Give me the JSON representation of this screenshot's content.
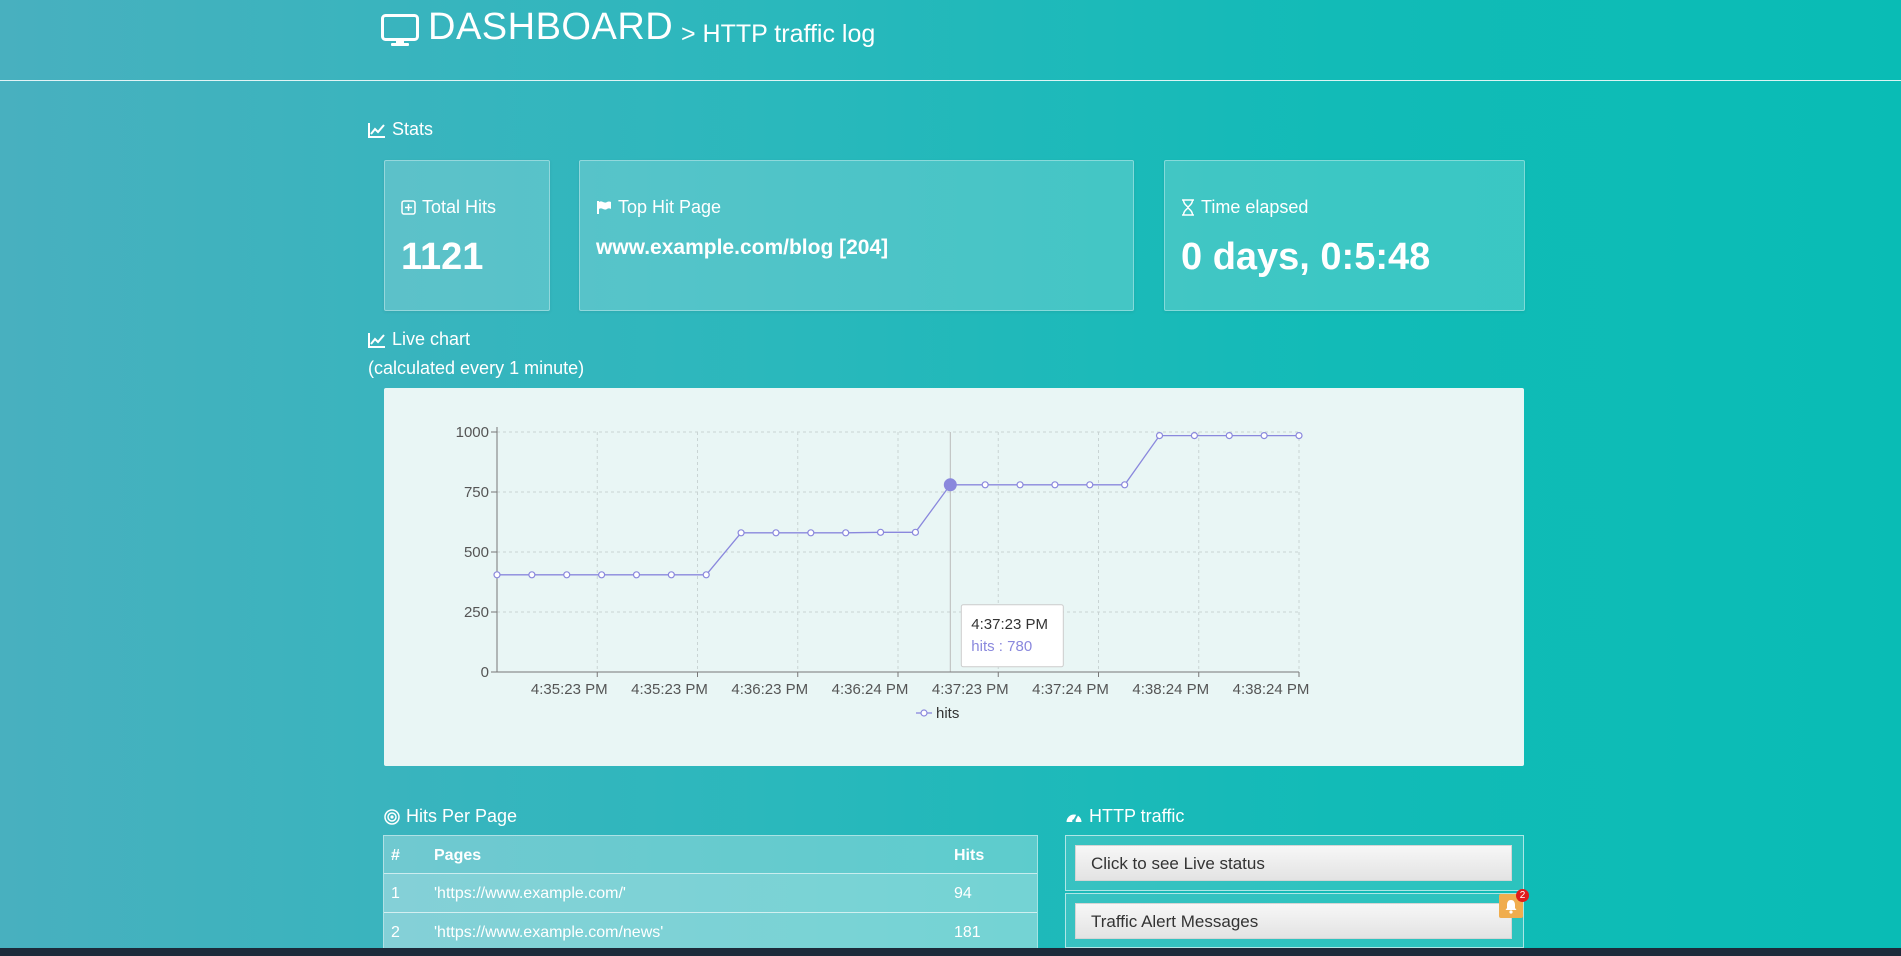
{
  "header": {
    "title": "DASHBOARD",
    "subtitle": "> HTTP traffic log"
  },
  "stats": {
    "label": "Stats",
    "total_hits": {
      "label": "Total Hits",
      "value": "1121"
    },
    "top_hit_page": {
      "label": "Top Hit Page",
      "value": "www.example.com/blog [204]"
    },
    "time_elapsed": {
      "label": "Time elapsed",
      "value": "0 days, 0:5:48"
    }
  },
  "live_chart": {
    "label": "Live chart",
    "note": "(calculated every 1 minute)"
  },
  "chart_data": {
    "type": "line",
    "series": [
      {
        "name": "hits",
        "values": [
          405,
          405,
          405,
          405,
          405,
          405,
          405,
          580,
          580,
          580,
          580,
          582,
          582,
          780,
          780,
          780,
          780,
          780,
          780,
          985,
          985,
          985,
          985,
          985
        ]
      }
    ],
    "x_tick_labels": [
      "4:35:23 PM",
      "4:35:23 PM",
      "4:36:23 PM",
      "4:36:24 PM",
      "4:37:23 PM",
      "4:37:24 PM",
      "4:38:24 PM",
      "4:38:24 PM"
    ],
    "y_ticks": [
      0,
      250,
      500,
      750,
      1000
    ],
    "ylim": [
      0,
      1000
    ],
    "grid": true,
    "legend": "bottom-center",
    "tooltip": {
      "time": "4:37:23 PM",
      "text": "hits : 780",
      "index": 13
    },
    "color": "#8a88dd"
  },
  "hits_per_page": {
    "label": "Hits Per Page",
    "columns": [
      "#",
      "Pages",
      "Hits"
    ],
    "rows": [
      [
        "1",
        "'https://www.example.com/'",
        "94"
      ],
      [
        "2",
        "'https://www.example.com/news'",
        "181"
      ]
    ]
  },
  "http_traffic": {
    "label": "HTTP traffic",
    "live_status_button": "Click to see Live status",
    "alerts_button": "Traffic Alert Messages",
    "alert_count": "2"
  }
}
